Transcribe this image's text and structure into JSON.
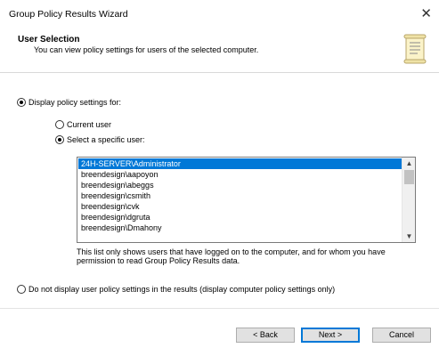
{
  "window": {
    "title": "Group Policy Results Wizard",
    "close_glyph": "✕"
  },
  "header": {
    "title": "User Selection",
    "subtitle": "You can view policy settings for users of the selected computer.",
    "icon": "wizard-document-icon"
  },
  "options": {
    "display_label": "Display policy settings for:",
    "display_selected": true,
    "current_user_label": "Current user",
    "current_user_selected": false,
    "specific_user_label": "Select a specific user:",
    "specific_user_selected": true,
    "no_display_label": "Do not display user policy settings in the results (display computer policy settings only)",
    "no_display_selected": false
  },
  "user_list": {
    "items": [
      "24H-SERVER\\Administrator",
      "breendesign\\aapoyon",
      "breendesign\\abeggs",
      "breendesign\\csmith",
      "breendesign\\cvk",
      "breendesign\\dgruta",
      "breendesign\\Dmahony"
    ],
    "selected_index": 0
  },
  "note": "This list only shows users that have logged on to the computer, and for whom you have permission to read Group Policy Results data.",
  "buttons": {
    "back": "< Back",
    "next": "Next >",
    "cancel": "Cancel"
  },
  "colors": {
    "selection": "#0078d7",
    "button_face": "#e1e1e1"
  }
}
